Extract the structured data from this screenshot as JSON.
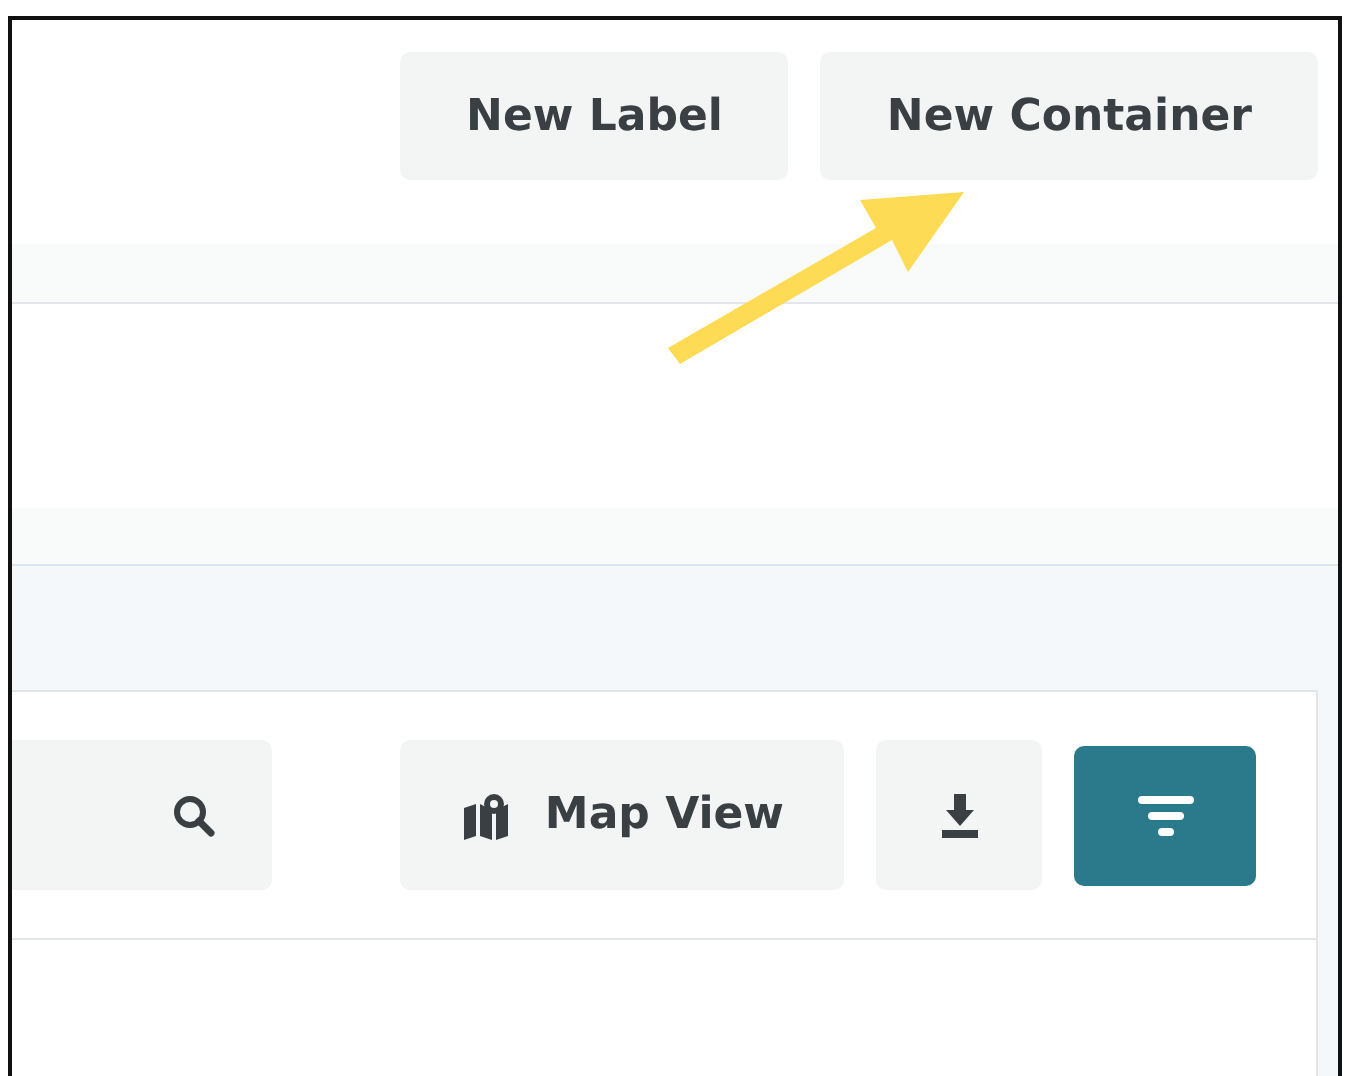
{
  "header": {
    "buttons": [
      {
        "label": "New Label"
      },
      {
        "label": "New Container"
      }
    ]
  },
  "toolbar": {
    "search": {
      "kind": "search"
    },
    "buttons": [
      {
        "kind": "map",
        "label": "Map View",
        "active": false
      },
      {
        "kind": "download",
        "active": false
      },
      {
        "kind": "filter",
        "active": true
      }
    ]
  }
}
